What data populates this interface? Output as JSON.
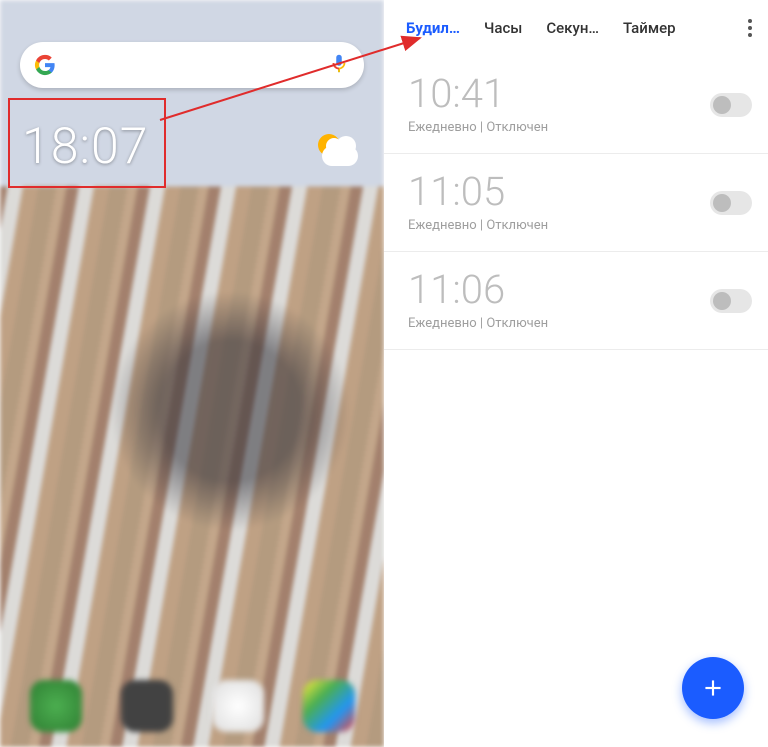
{
  "colors": {
    "accent": "#1b5cff",
    "highlight": "#e02c2c",
    "disabled_text": "#bdbdbd"
  },
  "home": {
    "clock_time": "18:07"
  },
  "clock_app": {
    "tabs": {
      "alarm": "Будил…",
      "clock": "Часы",
      "stopwatch": "Секун…",
      "timer": "Таймер"
    },
    "active_tab": "alarm",
    "alarms": [
      {
        "time": "10:41",
        "repeat": "Ежедневно",
        "sep": " | ",
        "status": "Отключен",
        "enabled": false
      },
      {
        "time": "11:05",
        "repeat": "Ежедневно",
        "sep": " | ",
        "status": "Отключен",
        "enabled": false
      },
      {
        "time": "11:06",
        "repeat": "Ежедневно",
        "sep": " | ",
        "status": "Отключен",
        "enabled": false
      }
    ]
  }
}
